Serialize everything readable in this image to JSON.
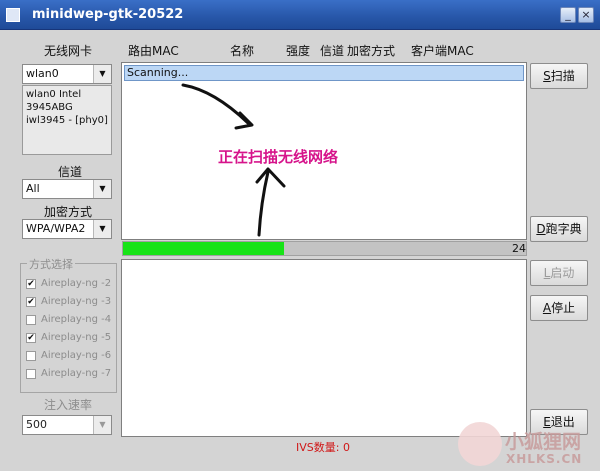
{
  "window": {
    "title": "minidwep-gtk-20522",
    "minimize_glyph": "_",
    "close_glyph": "×"
  },
  "left": {
    "adapter_label": "无线网卡",
    "adapter_value": "wlan0",
    "adapter_info": "wlan0 Intel 3945ABG iwl3945 - [phy0]",
    "channel_label": "信道",
    "channel_value": "All",
    "encryption_label": "加密方式",
    "encryption_value": "WPA/WPA2",
    "mode_group_title": "方式选择",
    "modes": [
      {
        "label": "Aireplay-ng -2",
        "checked": true
      },
      {
        "label": "Aireplay-ng -3",
        "checked": true
      },
      {
        "label": "Aireplay-ng -4",
        "checked": false
      },
      {
        "label": "Aireplay-ng -5",
        "checked": true
      },
      {
        "label": "Aireplay-ng -6",
        "checked": false
      },
      {
        "label": "Aireplay-ng -7",
        "checked": false
      }
    ],
    "inject_rate_label": "注入速率",
    "inject_rate_value": "500"
  },
  "columns": [
    "路由MAC",
    "名称",
    "强度",
    "信道",
    "加密方式",
    "客户端MAC"
  ],
  "list": {
    "rows": [
      "Scanning..."
    ]
  },
  "annotation": {
    "text": "正在扫描无线网络"
  },
  "progress": {
    "fraction": 0.4,
    "count": "24"
  },
  "buttons": {
    "scan": {
      "key": "S",
      "label": "扫描"
    },
    "dict": {
      "key": "D",
      "label": "跑字典"
    },
    "start": {
      "key": "L",
      "label": "启动"
    },
    "stop": {
      "key": "A",
      "label": "停止"
    },
    "quit": {
      "key": "E",
      "label": "退出"
    }
  },
  "status": {
    "ivs_text": "IVS数量: 0"
  },
  "watermark": {
    "text": "小狐狸网",
    "sub": "XHLKS.CN"
  },
  "colors": {
    "progress_fill": "#17e317",
    "annotation": "#d6148b",
    "ivs": "#d01818",
    "titlebar": "#2756a8"
  }
}
